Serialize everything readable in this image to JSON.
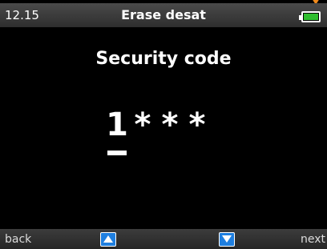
{
  "status_bar": {
    "time": "12.15",
    "title": "Erase desat",
    "battery_icon": "battery-full-icon",
    "battery_color": "#2ebe2e",
    "indicator_color": "#f08a1c"
  },
  "main": {
    "heading": "Security code",
    "code": {
      "entered_digit": "1",
      "masked": [
        "*",
        "*",
        "*"
      ]
    }
  },
  "softkeys": {
    "left_label": "back",
    "up_icon": "arrow-up-icon",
    "down_icon": "arrow-down-icon",
    "right_label": "next",
    "accent_color": "#1f7fe0"
  }
}
